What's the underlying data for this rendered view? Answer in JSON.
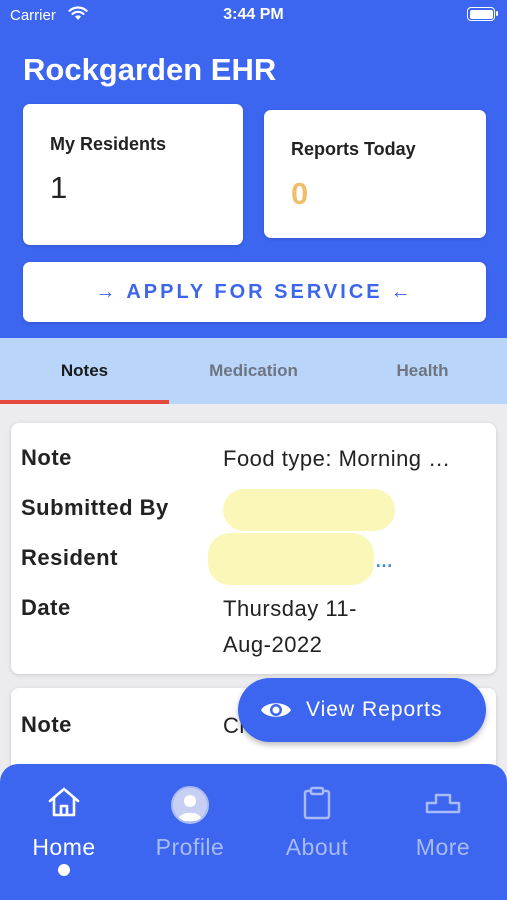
{
  "status_bar": {
    "carrier": "Carrier",
    "time": "3:44 PM"
  },
  "header": {
    "title": "Rockgarden EHR"
  },
  "stats": {
    "residents": {
      "label": "My Residents",
      "value": "1"
    },
    "reports": {
      "label": "Reports Today",
      "value": "0",
      "value_color": "#f1bd6a"
    }
  },
  "apply_button": {
    "label": "APPLY FOR SERVICE"
  },
  "tabs": [
    {
      "label": "Notes",
      "active": true
    },
    {
      "label": "Medication",
      "active": false
    },
    {
      "label": "Health",
      "active": false
    }
  ],
  "note_cards": [
    {
      "note_label": "Note",
      "note_value": "Food type: Morning …",
      "submitted_label": "Submitted By",
      "resident_label": "Resident",
      "resident_ellipsis": "…",
      "date_label": "Date",
      "date_line1": "Thursday 11-",
      "date_line2": "Aug-2022"
    },
    {
      "note_label": "Note",
      "note_value": "Cl"
    }
  ],
  "fab": {
    "label": "View Reports",
    "icon": "eye-icon"
  },
  "bottom_nav": [
    {
      "label": "Home",
      "icon": "home-icon",
      "active": true
    },
    {
      "label": "Profile",
      "icon": "avatar-icon",
      "active": false
    },
    {
      "label": "About",
      "icon": "clipboard-icon",
      "active": false
    },
    {
      "label": "More",
      "icon": "more-icon",
      "active": false
    }
  ],
  "colors": {
    "primary": "#3c65f0",
    "tab_bar": "#b9d6fa",
    "tab_indicator": "#e64a3d",
    "link": "#3c8dde"
  }
}
